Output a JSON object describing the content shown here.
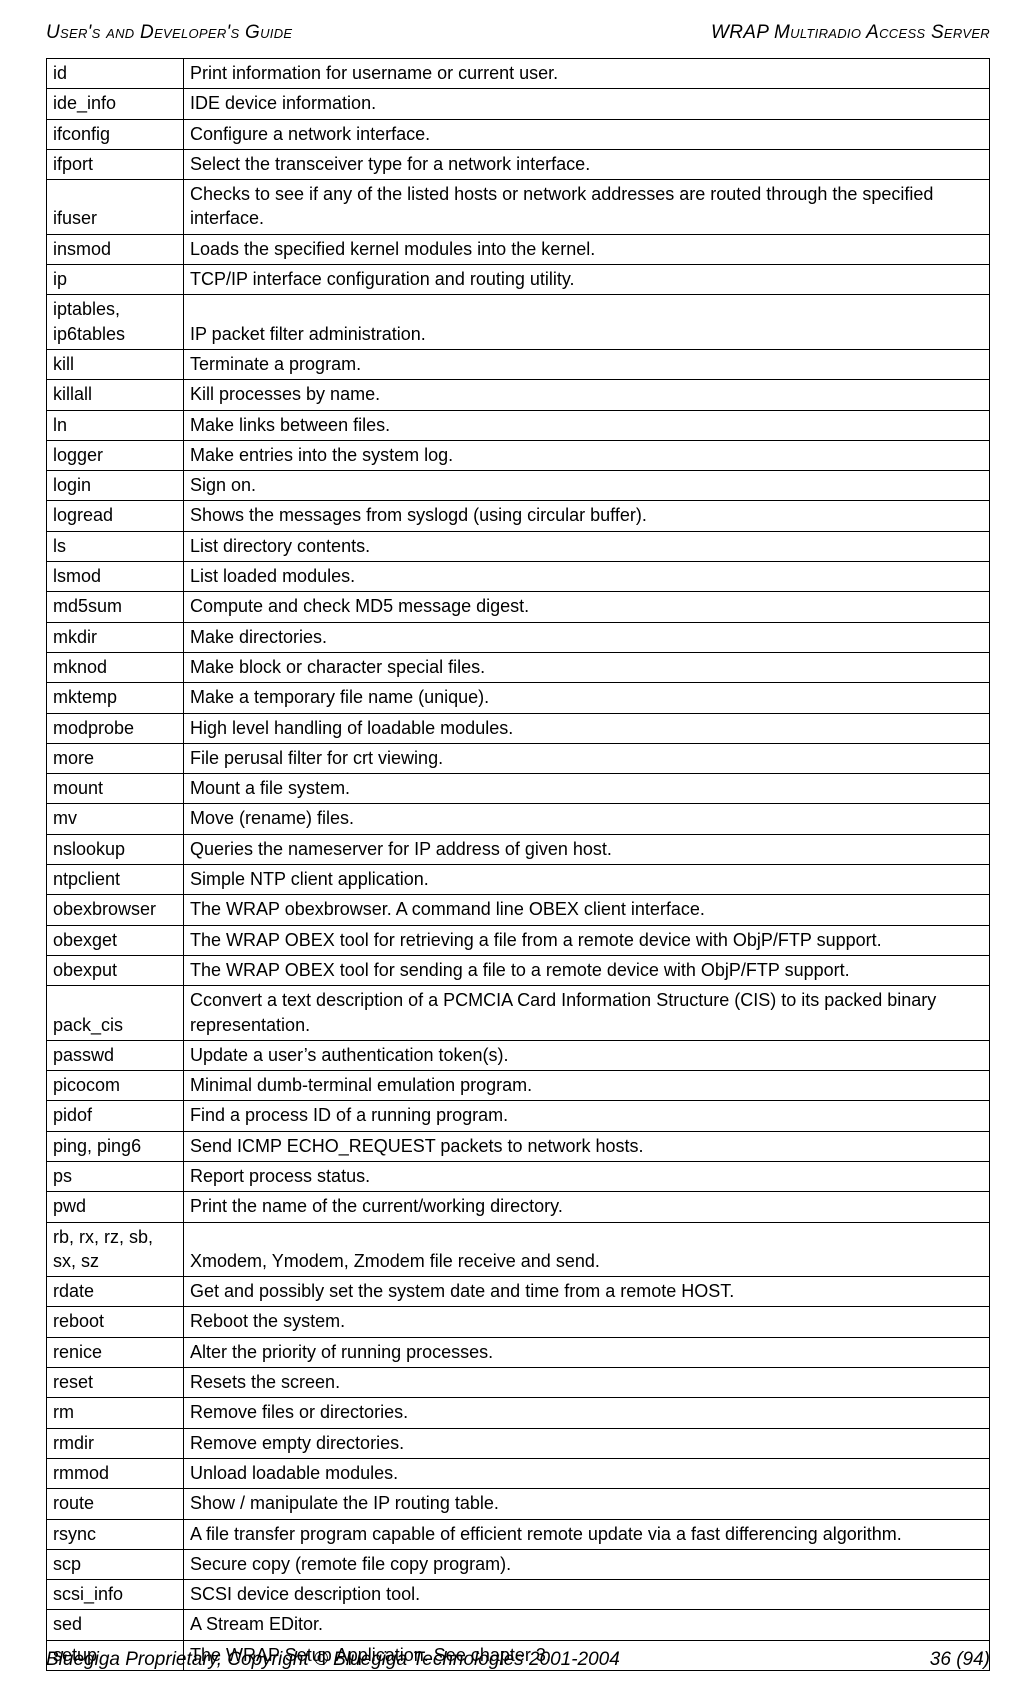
{
  "header": {
    "left": "User's and Developer's Guide",
    "right": "WRAP Multiradio Access Server"
  },
  "footer": {
    "left": "Bluegiga Proprietary, Copyright © Bluegiga Technologies 2001-2004",
    "right": "36 (94)"
  },
  "rows": [
    {
      "cmd": "id",
      "desc": "Print information for username or current user."
    },
    {
      "cmd": "ide_info",
      "desc": "IDE device information."
    },
    {
      "cmd": "ifconfig",
      "desc": "Configure a network interface."
    },
    {
      "cmd": "ifport",
      "desc": "Select the transceiver type for a network interface."
    },
    {
      "cmd": "ifuser",
      "desc": "Checks to see if any of the listed hosts or network addresses are routed through the specified interface."
    },
    {
      "cmd": "insmod",
      "desc": "Loads the specified kernel modules into the kernel."
    },
    {
      "cmd": "ip",
      "desc": "TCP/IP interface configuration and routing utility."
    },
    {
      "cmd": "iptables, ip6tables",
      "desc": "IP packet filter administration."
    },
    {
      "cmd": "kill",
      "desc": "Terminate a program."
    },
    {
      "cmd": "killall",
      "desc": "Kill processes by name."
    },
    {
      "cmd": "ln",
      "desc": "Make links between files."
    },
    {
      "cmd": "logger",
      "desc": "Make entries into the system log."
    },
    {
      "cmd": "login",
      "desc": "Sign on."
    },
    {
      "cmd": "logread",
      "desc": "Shows the messages from syslogd (using circular buffer)."
    },
    {
      "cmd": "ls",
      "desc": "List directory contents."
    },
    {
      "cmd": "lsmod",
      "desc": "List loaded modules."
    },
    {
      "cmd": "md5sum",
      "desc": "Compute and check MD5 message digest."
    },
    {
      "cmd": "mkdir",
      "desc": "Make directories."
    },
    {
      "cmd": "mknod",
      "desc": "Make block or character special files."
    },
    {
      "cmd": "mktemp",
      "desc": "Make a temporary file name (unique)."
    },
    {
      "cmd": "modprobe",
      "desc": "High level handling of loadable modules."
    },
    {
      "cmd": "more",
      "desc": "File perusal filter for crt viewing."
    },
    {
      "cmd": "mount",
      "desc": "Mount a file system."
    },
    {
      "cmd": "mv",
      "desc": "Move (rename) files."
    },
    {
      "cmd": "nslookup",
      "desc": "Queries the nameserver for IP address of given host."
    },
    {
      "cmd": "ntpclient",
      "desc": "Simple NTP client application."
    },
    {
      "cmd": "obexbrowser",
      "desc": "The WRAP obexbrowser. A command line OBEX client interface."
    },
    {
      "cmd": "obexget",
      "desc": "The WRAP OBEX tool for retrieving a file from a remote device with ObjP/FTP support."
    },
    {
      "cmd": "obexput",
      "desc": "The WRAP OBEX tool for sending a file to a remote device with ObjP/FTP support."
    },
    {
      "cmd": "pack_cis",
      "desc": "Cconvert a text description of a PCMCIA Card Information Structure (CIS) to its packed binary representation."
    },
    {
      "cmd": "passwd",
      "desc": "Update a user’s authentication token(s)."
    },
    {
      "cmd": "picocom",
      "desc": "Minimal dumb-terminal emulation program."
    },
    {
      "cmd": "pidof",
      "desc": "Find a process ID of a running program."
    },
    {
      "cmd": "ping, ping6",
      "desc": "Send ICMP ECHO_REQUEST packets to network hosts."
    },
    {
      "cmd": "ps",
      "desc": "Report process status."
    },
    {
      "cmd": "pwd",
      "desc": "Print the name of the current/working directory."
    },
    {
      "cmd": "rb, rx, rz, sb, sx, sz",
      "desc": "Xmodem, Ymodem, Zmodem file receive and send."
    },
    {
      "cmd": "rdate",
      "desc": "Get and possibly set the system date and time from a remote HOST."
    },
    {
      "cmd": "reboot",
      "desc": "Reboot the system."
    },
    {
      "cmd": "renice",
      "desc": "Alter the priority of running processes."
    },
    {
      "cmd": "reset",
      "desc": "Resets the screen."
    },
    {
      "cmd": "rm",
      "desc": "Remove files or directories."
    },
    {
      "cmd": "rmdir",
      "desc": "Remove empty directories."
    },
    {
      "cmd": "rmmod",
      "desc": "Unload loadable modules."
    },
    {
      "cmd": "route",
      "desc": "Show / manipulate the IP routing table."
    },
    {
      "cmd": "rsync",
      "desc": "A file transfer program capable of efficient remote update via a fast differencing algorithm."
    },
    {
      "cmd": "scp",
      "desc": "Secure copy (remote file copy program)."
    },
    {
      "cmd": "scsi_info",
      "desc": "SCSI device description tool."
    },
    {
      "cmd": "sed",
      "desc": "A Stream EDitor."
    },
    {
      "cmd": "setup",
      "desc": "The WRAP Setup Application. See chapter 3."
    }
  ]
}
